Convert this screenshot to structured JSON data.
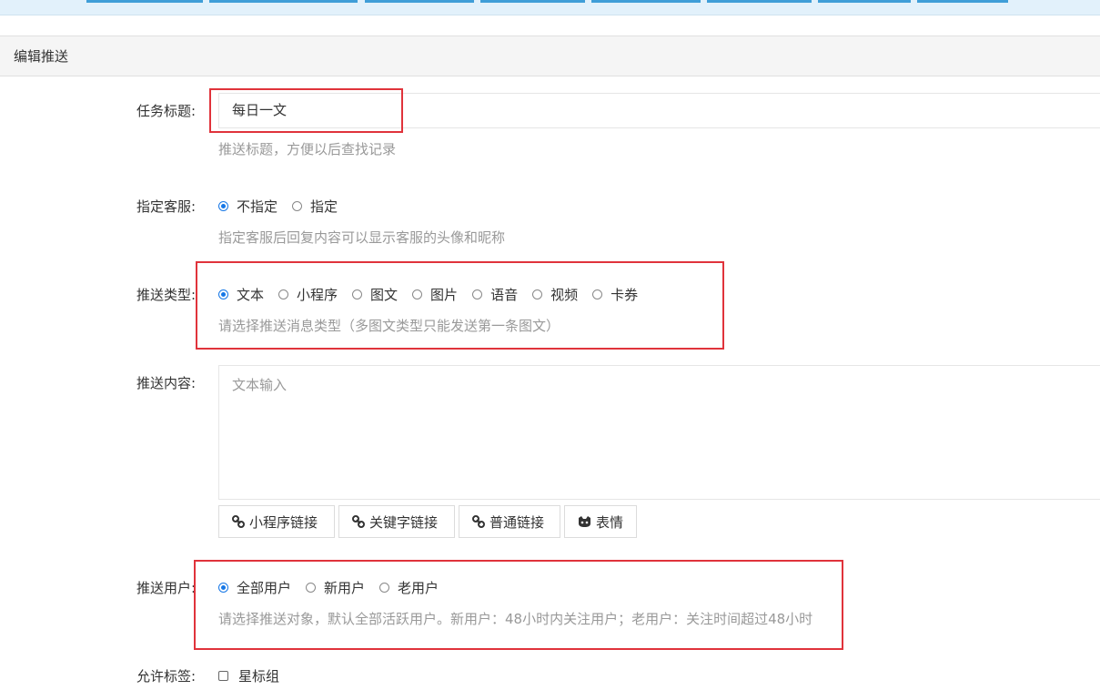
{
  "header": {
    "title": "编辑推送"
  },
  "task_title": {
    "label": "任务标题:",
    "value": "每日一文",
    "help": "推送标题，方便以后查找记录"
  },
  "service": {
    "label": "指定客服:",
    "options": [
      "不指定",
      "指定"
    ],
    "selected": "不指定",
    "help": "指定客服后回复内容可以显示客服的头像和昵称"
  },
  "push_type": {
    "label": "推送类型:",
    "options": [
      "文本",
      "小程序",
      "图文",
      "图片",
      "语音",
      "视频",
      "卡券"
    ],
    "selected": "文本",
    "help": "请选择推送消息类型（多图文类型只能发送第一条图文）"
  },
  "content": {
    "label": "推送内容:",
    "placeholder": "文本输入",
    "buttons": [
      "小程序链接",
      "关键字链接",
      "普通链接",
      "表情"
    ]
  },
  "push_user": {
    "label": "推送用户:",
    "options": [
      "全部用户",
      "新用户",
      "老用户"
    ],
    "selected": "全部用户",
    "help": "请选择推送对象，默认全部活跃用户。新用户：48小时内关注用户；老用户：关注时间超过48小时"
  },
  "tags": {
    "label": "允许标签:",
    "options": [
      "星标组"
    ]
  },
  "colors": {
    "accent": "#1677e6",
    "highlight": "#e0333b",
    "help_text": "#999999"
  }
}
